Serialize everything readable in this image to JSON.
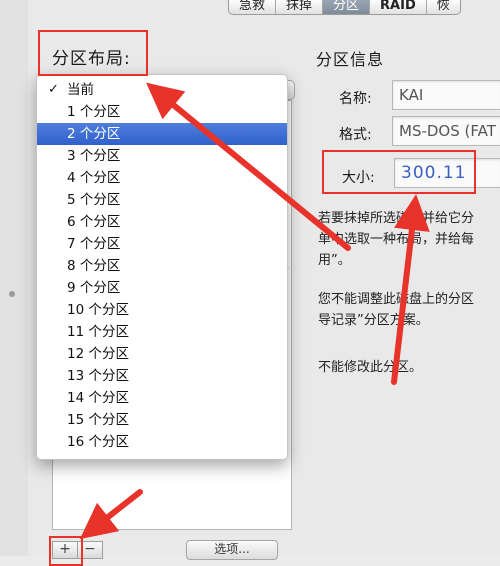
{
  "tabs": [
    {
      "label": "急救",
      "selected": false
    },
    {
      "label": "抹掉",
      "selected": false
    },
    {
      "label": "分区",
      "selected": true
    },
    {
      "label": "RAID",
      "selected": false
    },
    {
      "label": "恢",
      "selected": false
    }
  ],
  "layout": {
    "title": "分区布局:",
    "menu_items": [
      {
        "label": "当前",
        "checked": true,
        "highlighted": false
      },
      {
        "label": "1 个分区",
        "checked": false,
        "highlighted": false
      },
      {
        "label": "2 个分区",
        "checked": false,
        "highlighted": true
      },
      {
        "label": "3 个分区",
        "checked": false,
        "highlighted": false
      },
      {
        "label": "4 个分区",
        "checked": false,
        "highlighted": false
      },
      {
        "label": "5 个分区",
        "checked": false,
        "highlighted": false
      },
      {
        "label": "6 个分区",
        "checked": false,
        "highlighted": false
      },
      {
        "label": "7 个分区",
        "checked": false,
        "highlighted": false
      },
      {
        "label": "8 个分区",
        "checked": false,
        "highlighted": false
      },
      {
        "label": "9 个分区",
        "checked": false,
        "highlighted": false
      },
      {
        "label": "10 个分区",
        "checked": false,
        "highlighted": false
      },
      {
        "label": "11 个分区",
        "checked": false,
        "highlighted": false
      },
      {
        "label": "12 个分区",
        "checked": false,
        "highlighted": false
      },
      {
        "label": "13 个分区",
        "checked": false,
        "highlighted": false
      },
      {
        "label": "14 个分区",
        "checked": false,
        "highlighted": false
      },
      {
        "label": "15 个分区",
        "checked": false,
        "highlighted": false
      },
      {
        "label": "16 个分区",
        "checked": false,
        "highlighted": false
      }
    ],
    "check_glyph": "✓",
    "add_label": "+",
    "remove_label": "−",
    "options_label": "选项..."
  },
  "info": {
    "title": "分区信息",
    "name_label": "名称:",
    "name_value": "KAI",
    "format_label": "格式:",
    "format_value": "MS-DOS (FAT",
    "size_label": "大小:",
    "size_value": "300.11",
    "desc_lines": [
      "若要抹掉所选磁盘并给它分",
      "单中选取一种布局，并给每",
      "用”。"
    ],
    "warn_lines": [
      "您不能调整此磁盘上的分区",
      "导记录”分区方案。"
    ],
    "nomod_text": "不能修改此分区。"
  },
  "colors": {
    "annotation": "#e8332a",
    "highlight": "#3366cc",
    "size_text": "#3b5fbf"
  }
}
